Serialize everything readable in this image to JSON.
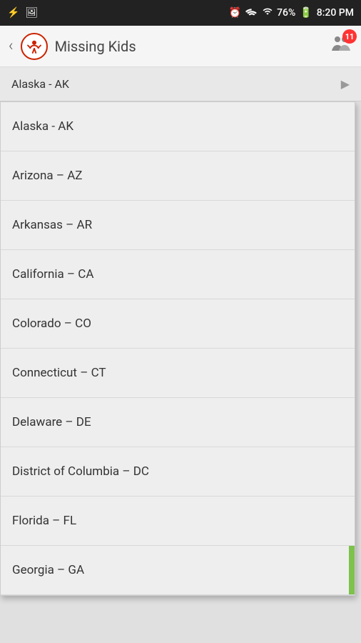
{
  "statusBar": {
    "time": "8:20 PM",
    "battery": "76%",
    "icons": [
      "usb",
      "image",
      "alarm",
      "wifi",
      "signal",
      "battery"
    ]
  },
  "appBar": {
    "title": "Missing Kids",
    "notificationCount": "11"
  },
  "selectedValue": "Alaska - AK",
  "dropdownItems": [
    {
      "label": "Alaska - AK"
    },
    {
      "label": "Arizona – AZ"
    },
    {
      "label": "Arkansas – AR"
    },
    {
      "label": "California – CA"
    },
    {
      "label": "Colorado – CO"
    },
    {
      "label": "Connecticut – CT"
    },
    {
      "label": "Delaware – DE"
    },
    {
      "label": "District of Columbia – DC"
    },
    {
      "label": "Florida – FL"
    },
    {
      "label": "Georgia – GA"
    }
  ]
}
